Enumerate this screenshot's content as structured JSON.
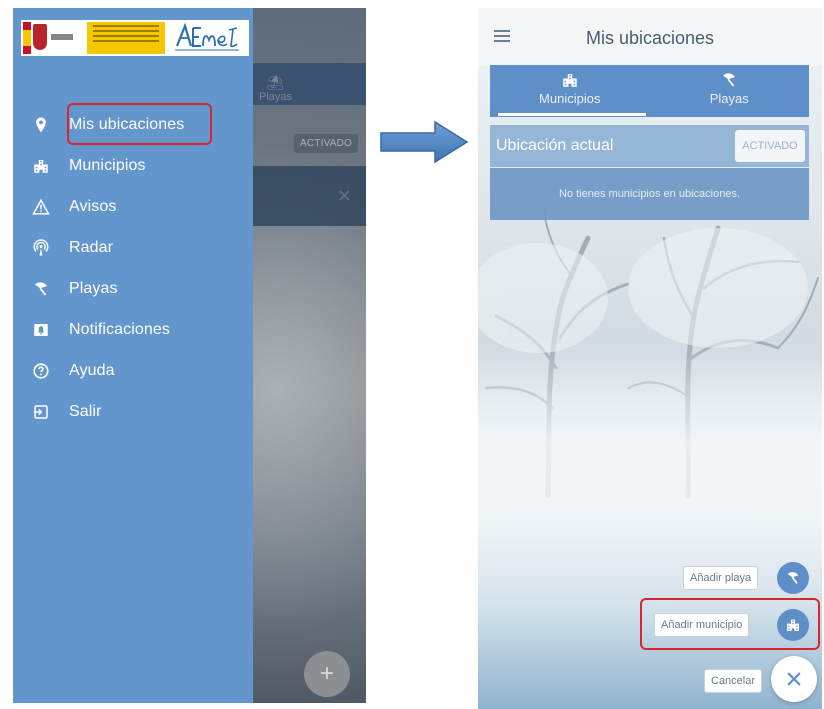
{
  "left": {
    "under": {
      "playas_label": "Playas",
      "activado_label": "ACTIVADO",
      "fab_symbol": "+"
    },
    "drawer": {
      "items": [
        {
          "label": "Mis ubicaciones",
          "icon": "location-pin-icon"
        },
        {
          "label": "Municipios",
          "icon": "buildings-icon"
        },
        {
          "label": "Avisos",
          "icon": "warning-triangle-icon"
        },
        {
          "label": "Radar",
          "icon": "radar-icon"
        },
        {
          "label": "Playas",
          "icon": "beach-umbrella-icon"
        },
        {
          "label": "Notificaciones",
          "icon": "notification-icon"
        },
        {
          "label": "Ayuda",
          "icon": "help-icon"
        },
        {
          "label": "Salir",
          "icon": "exit-icon"
        }
      ]
    }
  },
  "right": {
    "topbar": {
      "title": "Mis ubicaciones"
    },
    "tabs": [
      {
        "label": "Municipios",
        "icon": "buildings-icon"
      },
      {
        "label": "Playas",
        "icon": "beach-umbrella-icon"
      }
    ],
    "current_location": {
      "label": "Ubicación actual",
      "toggle_label": "ACTIVADO"
    },
    "empty_message": "No tienes municipios en ubicaciones.",
    "fab_menu": {
      "add_beach": "Añadir playa",
      "add_municipality": "Añadir municipio",
      "cancel": "Cancelar"
    }
  },
  "colors": {
    "drawer": "#6396cd",
    "accent": "#5f8fc8",
    "highlight": "#d8262c",
    "arrow": "#4f86c6"
  }
}
